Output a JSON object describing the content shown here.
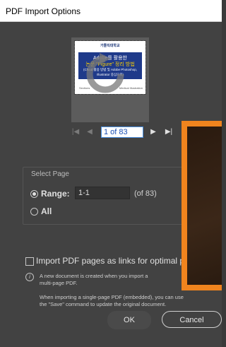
{
  "window": {
    "title": "PDF Import Options"
  },
  "preview": {
    "logo": "가톨릭대학교",
    "title_line1": "Adobe를 활용한",
    "title_line2": "논문 \"Figure\" 정리 방법",
    "subtitle_line1": "(Cloud 활용 방법 및 Adobe Photoshop,",
    "subtitle_line2": "Illustrator 중심으로)",
    "footer_left": "Sections",
    "footer_right": "Medical Illustration",
    "colors": {
      "band": "#1f3a8a",
      "highlight": "#ffd200"
    }
  },
  "nav": {
    "page_value": "1 of 83",
    "first_icon": "first-page-icon",
    "prev_icon": "prev-page-icon",
    "next_icon": "next-page-icon",
    "last_icon": "last-page-icon"
  },
  "select_page": {
    "group_label": "Select Page",
    "range_label": "Range:",
    "range_value": "1-1",
    "of_text": "(of 83)",
    "all_label": "All"
  },
  "options": {
    "links_label": "Import PDF pages as links for optimal per"
  },
  "info": {
    "icon": "info-icon",
    "para1_line1": "A new document is created when you import a",
    "para1_line2": "multi-page PDF.",
    "para2_line1": "When importing a single-page PDF (embedded), you can use",
    "para2_line2": "the \"Save\" command to update the original document."
  },
  "buttons": {
    "ok": "OK",
    "cancel": "Cancel"
  },
  "accent_colors": {
    "overlay_frame": "#f0841e",
    "page_input_border": "#4a90e2"
  }
}
